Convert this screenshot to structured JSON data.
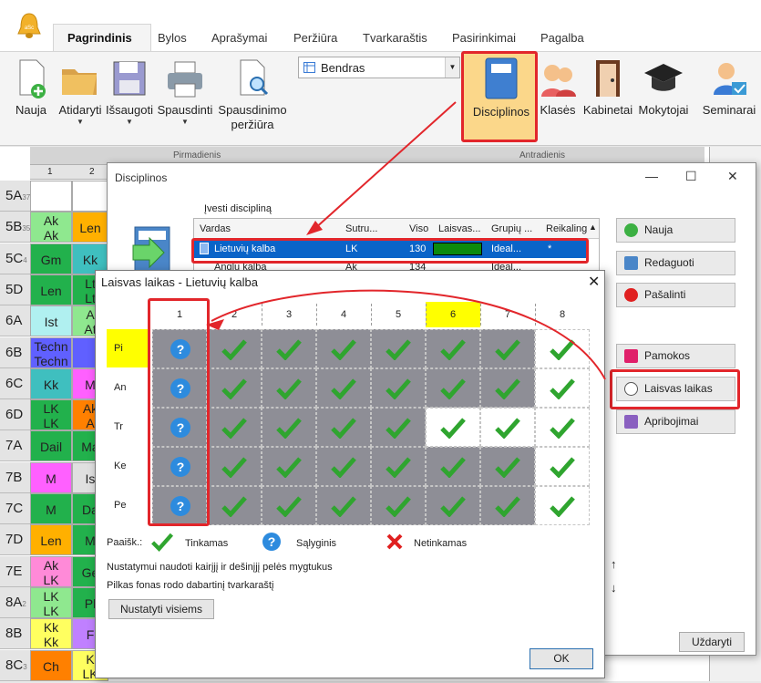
{
  "ribbon": {
    "tabs": [
      "Pagrindinis",
      "Bylos",
      "Aprašymai",
      "Peržiūra",
      "Tvarkaraštis",
      "Pasirinkimai",
      "Pagalba"
    ],
    "buttons": {
      "nauja": "Nauja",
      "atidaryti": "Atidaryti",
      "issaugoti": "Išsaugoti",
      "spausdinti": "Spausdinti",
      "perziura_l1": "Spausdinimo",
      "perziura_l2": "peržiūra",
      "disciplinos": "Disciplinos",
      "klases": "Klasės",
      "kabinetai": "Kabinetai",
      "mokytojai": "Mokytojai",
      "seminarai": "Seminarai"
    },
    "combo_value": "Bendras"
  },
  "timetable": {
    "days": [
      "Pirmadienis",
      "Antradienis"
    ],
    "periods": [
      "1",
      "2"
    ],
    "rows": [
      {
        "label": "5A",
        "sub": "37",
        "c1": "",
        "c2": "",
        "col1": "#ffffff",
        "col2": "#ffffff"
      },
      {
        "label": "5B",
        "sub": "35",
        "c1": "Ak\nAk",
        "c2": "Len",
        "col1": "#8fe88f",
        "col2": "#ffb000"
      },
      {
        "label": "5C",
        "sub": "4",
        "c1": "Gm",
        "c2": "Kk",
        "col1": "#22b14c",
        "col2": "#3fbfbf"
      },
      {
        "label": "5D",
        "sub": "",
        "c1": "Len",
        "c2": "Lt\nLt",
        "col1": "#22b14c",
        "col2": "#22b14c"
      },
      {
        "label": "6A",
        "sub": "",
        "c1": "Ist",
        "c2": "A\nAt",
        "col1": "#b0f0f0",
        "col2": "#8fe88f"
      },
      {
        "label": "6B",
        "sub": "",
        "c1": "Techn\nTechn",
        "c2": "",
        "col1": "#6060ff",
        "col2": "#6060ff"
      },
      {
        "label": "6C",
        "sub": "",
        "c1": "Kk",
        "c2": "M",
        "col1": "#3fbfbf",
        "col2": "#ff60ff"
      },
      {
        "label": "6D",
        "sub": "",
        "c1": "LK\nLK",
        "c2": "Ak\nA",
        "col1": "#22b14c",
        "col2": "#ff8000"
      },
      {
        "label": "7A",
        "sub": "",
        "c1": "Dail",
        "c2": "Ma",
        "col1": "#22b14c",
        "col2": "#22b14c"
      },
      {
        "label": "7B",
        "sub": "",
        "c1": "M",
        "c2": "Is",
        "col1": "#ff60ff",
        "col2": "#e0e0e0"
      },
      {
        "label": "7C",
        "sub": "",
        "c1": "M",
        "c2": "Da",
        "col1": "#22b14c",
        "col2": "#22b14c"
      },
      {
        "label": "7D",
        "sub": "",
        "c1": "Len",
        "c2": "M",
        "col1": "#ffb000",
        "col2": "#22b14c"
      },
      {
        "label": "7E",
        "sub": "",
        "c1": "Ak\nLK",
        "c2": "Ge",
        "col1": "#ff8ad8",
        "col2": "#22b14c"
      },
      {
        "label": "8A",
        "sub": "2",
        "c1": "LK\nLK",
        "c2": "Pl",
        "col1": "#8fe88f",
        "col2": "#22b14c"
      },
      {
        "label": "8B",
        "sub": "",
        "c1": "Kk\nKk",
        "c2": "F",
        "col1": "#ffff60",
        "col2": "#c080ff"
      },
      {
        "label": "8C",
        "sub": "3",
        "c1": "Ch",
        "c2": "K\nLK",
        "col1": "#ff8000",
        "col2": "#ffff60"
      }
    ]
  },
  "disciplinos_dialog": {
    "title": "Disciplinos",
    "prompt": "Įvesti discipliną",
    "columns": [
      "Vardas",
      "Sutru...",
      "Viso",
      "Laisvas...",
      "Grupių ...",
      "Reikaling"
    ],
    "selected_row": {
      "vardas": "Lietuvių kalba",
      "sutrumpinimas": "LK",
      "viso": "130",
      "grupes": "Ideal...",
      "reikalinga": "*"
    },
    "second_row": {
      "vardas": "Anglų kalba",
      "sutrumpinimas": "Ak",
      "viso": "134",
      "grupes": "Ideal..."
    },
    "side_buttons": {
      "nauja": "Nauja",
      "redaguoti": "Redaguoti",
      "pasalinti": "Pašalinti",
      "pamokos": "Pamokos",
      "laisvas": "Laisvas laikas",
      "apribojimai": "Apribojimai"
    },
    "arrows": {
      "up": "↑",
      "down": "↓"
    },
    "close_label": "Uždaryti"
  },
  "laisvas_dialog": {
    "title": "Laisvas laikas - Lietuvių kalba",
    "columns": [
      "1",
      "2",
      "3",
      "4",
      "5",
      "6",
      "7",
      "8"
    ],
    "highlight_column": "6",
    "days": [
      "Pi",
      "An",
      "Tr",
      "Ke",
      "Pe"
    ],
    "legend": {
      "label": "Paaišk.:",
      "tinkamas": "Tinkamas",
      "salyginis": "Sąlyginis",
      "netinkamas": "Netinkamas"
    },
    "hint1": "Nustatymui naudoti kairįjį ir dešinįjį pelės mygtukus",
    "hint2": "Pilkas fonas rodo dabartinį tvarkaraštį",
    "set_all": "Nustatyti visiems",
    "ok": "OK",
    "question_mark": "?",
    "states": [
      [
        "q",
        "v",
        "v",
        "v",
        "v",
        "v",
        "v",
        "v"
      ],
      [
        "q",
        "v",
        "v",
        "v",
        "v",
        "v",
        "v",
        "v"
      ],
      [
        "q",
        "v",
        "v",
        "v",
        "v",
        "v",
        "v",
        "v"
      ],
      [
        "q",
        "v",
        "v",
        "v",
        "v",
        "v",
        "v",
        "v"
      ],
      [
        "q",
        "v",
        "v",
        "v",
        "v",
        "v",
        "v",
        "v"
      ]
    ],
    "gray": [
      [
        1,
        1,
        1,
        1,
        1,
        1,
        1,
        0
      ],
      [
        1,
        1,
        1,
        1,
        1,
        1,
        1,
        0
      ],
      [
        1,
        1,
        1,
        1,
        1,
        0,
        0,
        0
      ],
      [
        1,
        1,
        1,
        1,
        1,
        1,
        1,
        0
      ],
      [
        1,
        1,
        1,
        1,
        1,
        1,
        1,
        0
      ]
    ]
  },
  "colors": {
    "accent_red": "#e2262b",
    "selection": "#0a64c8",
    "check": "#2fa52f",
    "qm": "#2d8bde",
    "highlight": "#ffff00"
  }
}
